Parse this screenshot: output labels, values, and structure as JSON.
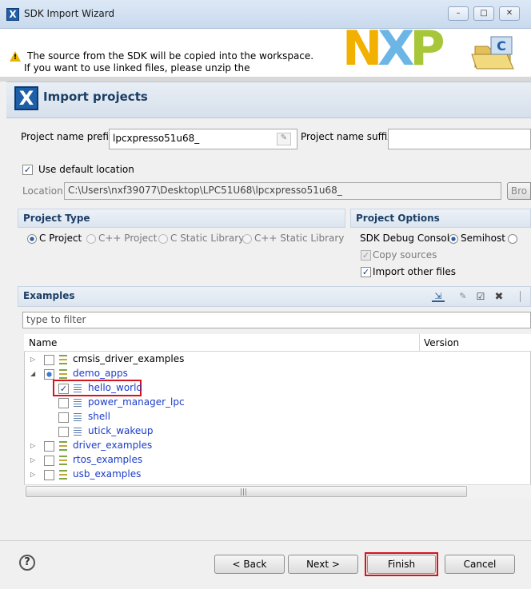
{
  "window": {
    "title": "SDK Import Wizard",
    "minimize": "–",
    "maximize": "□",
    "close": "✕"
  },
  "banner": {
    "line1": "The source from the SDK will be copied into the workspace.",
    "line2": "If you want to use linked files, please unzip the",
    "logo": {
      "n": "N",
      "x": "X",
      "p": "P",
      "c": "C"
    }
  },
  "header": {
    "title": "Import projects",
    "icon_text": "X"
  },
  "project": {
    "prefix_label": "Project name prefix:",
    "prefix_value": "lpcxpresso51u68_",
    "suffix_label": "Project name suffix:",
    "suffix_value": "",
    "use_default_label": "Use default location",
    "location_label": "Location:",
    "location_value": "C:\\Users\\nxf39077\\Desktop\\LPC51U68\\lpcxpresso51u68_",
    "browse_label": "Bro"
  },
  "project_type": {
    "title": "Project Type",
    "options": [
      "C Project",
      "C++ Project",
      "C Static Library",
      "C++ Static Library"
    ]
  },
  "project_options": {
    "title": "Project Options",
    "debug_console_label": "SDK Debug Console",
    "semihost_label": "Semihost",
    "copy_sources_label": "Copy sources",
    "import_other_label": "Import other files"
  },
  "examples": {
    "title": "Examples",
    "filter_placeholder": "type to filter",
    "col_name": "Name",
    "col_version": "Version",
    "items": [
      {
        "label": "cmsis_driver_examples"
      },
      {
        "label": "demo_apps"
      },
      {
        "label": "hello_world"
      },
      {
        "label": "power_manager_lpc"
      },
      {
        "label": "shell"
      },
      {
        "label": "utick_wakeup"
      },
      {
        "label": "driver_examples"
      },
      {
        "label": "rtos_examples"
      },
      {
        "label": "usb_examples"
      }
    ],
    "scroll_grip": "|||"
  },
  "footer": {
    "help": "?",
    "back": "< Back",
    "next": "Next >",
    "finish": "Finish",
    "cancel": "Cancel"
  },
  "colors": {
    "accent": "#1c3f66",
    "highlight": "#d6141c",
    "link": "#1a3cc8",
    "nxp_yellow": "#f2b100",
    "nxp_blue": "#6cb6e6",
    "nxp_green": "#a7c638"
  }
}
